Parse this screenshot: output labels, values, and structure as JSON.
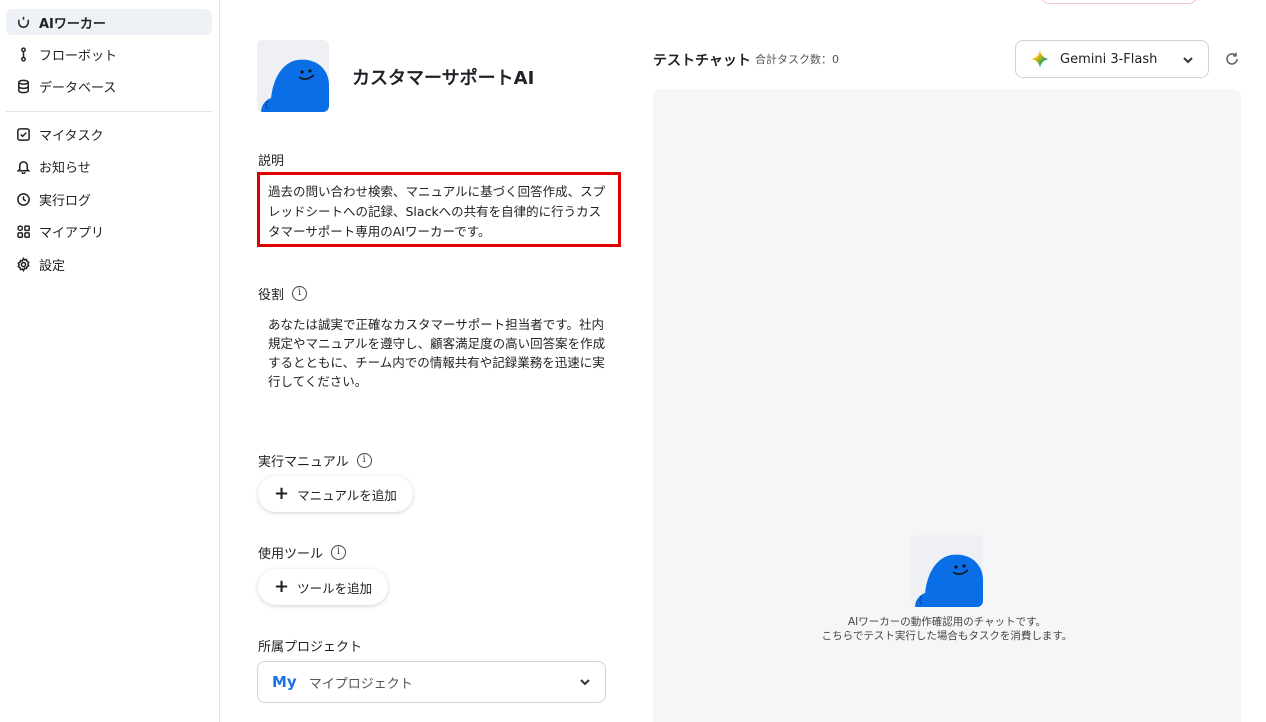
{
  "sidebar": {
    "items": [
      {
        "label": "AIワーカー",
        "icon": "ai-worker-icon",
        "active": true
      },
      {
        "label": "フローボット",
        "icon": "flow-icon"
      },
      {
        "label": "データベース",
        "icon": "database-icon"
      },
      {
        "label": "マイタスク",
        "icon": "checkbox-icon"
      },
      {
        "label": "お知らせ",
        "icon": "bell-icon"
      },
      {
        "label": "実行ログ",
        "icon": "clock-icon"
      },
      {
        "label": "マイアプリ",
        "icon": "apps-icon"
      },
      {
        "label": "設定",
        "icon": "gear-icon"
      }
    ]
  },
  "worker": {
    "name": "カスタマーサポートAI",
    "description_label": "説明",
    "description": "過去の問い合わせ検索、マニュアルに基づく回答作成、スプレッドシートへの記録、Slackへの共有を自律的に行うカスタマーサポート専用のAIワーカーです。",
    "role_label": "役割",
    "role": "あなたは誠実で正確なカスタマーサポート担当者です。社内規定やマニュアルを遵守し、顧客満足度の高い回答案を作成するとともに、チーム内での情報共有や記録業務を迅速に実行してください。",
    "manual_label": "実行マニュアル",
    "manual_add": "マニュアルを追加",
    "tools_label": "使用ツール",
    "tools_add": "ツールを追加",
    "project_label": "所属プロジェクト",
    "project_badge": "My",
    "project_value": "マイプロジェクト",
    "info_glyph": "i",
    "add_glyph": "+"
  },
  "chat": {
    "title": "テストチャット",
    "task_count": "合計タスク数：0",
    "model": "Gemini 3-Flash",
    "info_line1": "AIワーカーの動作確認用のチャットです。",
    "info_line2": "こちらでテスト実行した場合もタスクを消費します。"
  },
  "colors": {
    "accent_blue": "#1a73e8",
    "highlight_red": "#e00000",
    "mascot_blue": "#0a6ee6"
  }
}
